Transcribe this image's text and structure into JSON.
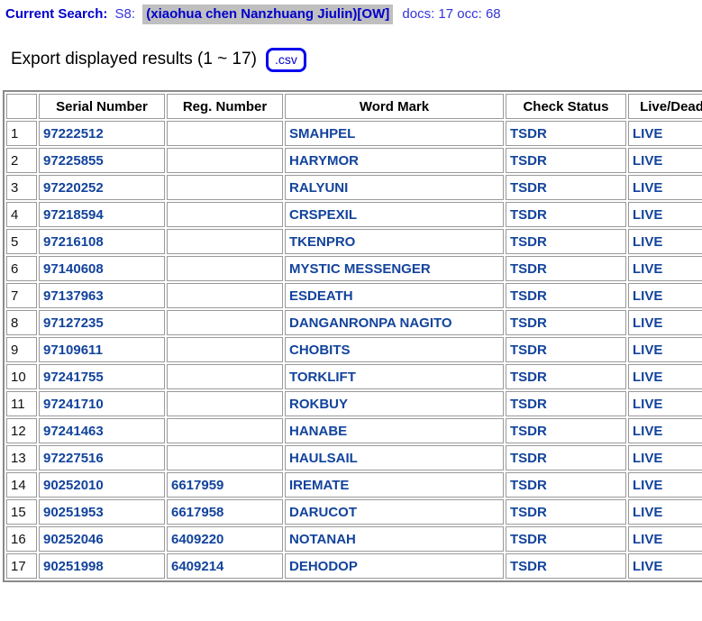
{
  "search_bar": {
    "label": "Current Search:",
    "session_id": "S8:",
    "query": "(xiaohua chen Nanzhuang Jiulin)[OW]",
    "counts": "docs: 17 occ: 68",
    "highlight_color": "#bfbfbf",
    "text_color": "#0000cc"
  },
  "export": {
    "text": "Export displayed results (1 ~ 17)",
    "csv_label": ".csv",
    "button_border_color": "#0000ee"
  },
  "table": {
    "columns": [
      "",
      "Serial Number",
      "Reg. Number",
      "Word Mark",
      "Check Status",
      "Live/Dead"
    ],
    "link_color": "#12439c",
    "rows": [
      {
        "num": "1",
        "serial": "97222512",
        "reg": "",
        "mark": "SMAHPEL",
        "check": "TSDR",
        "live": "LIVE"
      },
      {
        "num": "2",
        "serial": "97225855",
        "reg": "",
        "mark": "HARYMOR",
        "check": "TSDR",
        "live": "LIVE"
      },
      {
        "num": "3",
        "serial": "97220252",
        "reg": "",
        "mark": "RALYUNI",
        "check": "TSDR",
        "live": "LIVE"
      },
      {
        "num": "4",
        "serial": "97218594",
        "reg": "",
        "mark": "CRSPEXIL",
        "check": "TSDR",
        "live": "LIVE"
      },
      {
        "num": "5",
        "serial": "97216108",
        "reg": "",
        "mark": "TKENPRO",
        "check": "TSDR",
        "live": "LIVE"
      },
      {
        "num": "6",
        "serial": "97140608",
        "reg": "",
        "mark": "MYSTIC MESSENGER",
        "check": "TSDR",
        "live": "LIVE"
      },
      {
        "num": "7",
        "serial": "97137963",
        "reg": "",
        "mark": "ESDEATH",
        "check": "TSDR",
        "live": "LIVE"
      },
      {
        "num": "8",
        "serial": "97127235",
        "reg": "",
        "mark": "DANGANRONPA NAGITO",
        "check": "TSDR",
        "live": "LIVE"
      },
      {
        "num": "9",
        "serial": "97109611",
        "reg": "",
        "mark": "CHOBITS",
        "check": "TSDR",
        "live": "LIVE"
      },
      {
        "num": "10",
        "serial": "97241755",
        "reg": "",
        "mark": "TORKLIFT",
        "check": "TSDR",
        "live": "LIVE"
      },
      {
        "num": "11",
        "serial": "97241710",
        "reg": "",
        "mark": "ROKBUY",
        "check": "TSDR",
        "live": "LIVE"
      },
      {
        "num": "12",
        "serial": "97241463",
        "reg": "",
        "mark": "HANABE",
        "check": "TSDR",
        "live": "LIVE"
      },
      {
        "num": "13",
        "serial": "97227516",
        "reg": "",
        "mark": "HAULSAIL",
        "check": "TSDR",
        "live": "LIVE"
      },
      {
        "num": "14",
        "serial": "90252010",
        "reg": "6617959",
        "mark": "IREMATE",
        "check": "TSDR",
        "live": "LIVE"
      },
      {
        "num": "15",
        "serial": "90251953",
        "reg": "6617958",
        "mark": "DARUCOT",
        "check": "TSDR",
        "live": "LIVE"
      },
      {
        "num": "16",
        "serial": "90252046",
        "reg": "6409220",
        "mark": "NOTANAH",
        "check": "TSDR",
        "live": "LIVE"
      },
      {
        "num": "17",
        "serial": "90251998",
        "reg": "6409214",
        "mark": "DEHODOP",
        "check": "TSDR",
        "live": "LIVE"
      }
    ]
  }
}
